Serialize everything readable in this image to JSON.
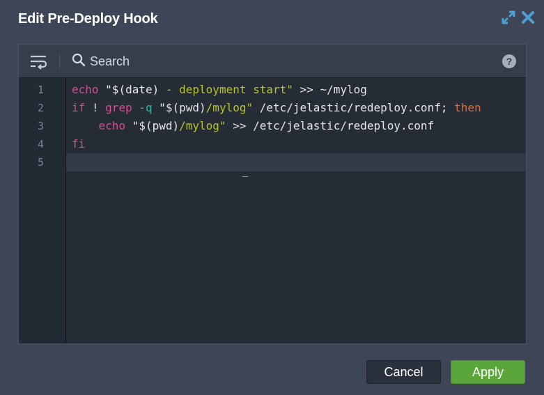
{
  "dialog": {
    "title": "Edit Pre-Deploy Hook"
  },
  "toolbar": {
    "wrap_icon": "word-wrap-icon",
    "search_label": "Search",
    "help_label": "?"
  },
  "editor": {
    "line_numbers": [
      "1",
      "2",
      "3",
      "4",
      "5"
    ],
    "lines": [
      {
        "tokens": [
          {
            "t": "echo",
            "c": "kw"
          },
          {
            "t": " ",
            "c": "plain"
          },
          {
            "t": "\"$(date) ",
            "c": "str-base"
          },
          {
            "t": "- deployment start\"",
            "c": "str"
          },
          {
            "t": " >> ~/mylog",
            "c": "plain"
          }
        ]
      },
      {
        "tokens": [
          {
            "t": "if",
            "c": "kw"
          },
          {
            "t": " ! ",
            "c": "plain"
          },
          {
            "t": "grep",
            "c": "kw"
          },
          {
            "t": " ",
            "c": "plain"
          },
          {
            "t": "-q",
            "c": "flag"
          },
          {
            "t": " \"$(pwd)",
            "c": "plain"
          },
          {
            "t": "/mylog\"",
            "c": "str"
          },
          {
            "t": " /etc/jelastic/redeploy.conf; ",
            "c": "plain"
          },
          {
            "t": "then",
            "c": "kw2"
          }
        ]
      },
      {
        "tokens": [
          {
            "t": "    ",
            "c": "plain"
          },
          {
            "t": "echo",
            "c": "kw"
          },
          {
            "t": " \"$(pwd)",
            "c": "plain"
          },
          {
            "t": "/mylog\"",
            "c": "str"
          },
          {
            "t": " >> /etc/jelastic/redeploy.conf",
            "c": "plain"
          }
        ]
      },
      {
        "tokens": [
          {
            "t": "fi",
            "c": "kw"
          }
        ]
      },
      {
        "tokens": []
      }
    ]
  },
  "buttons": {
    "cancel": "Cancel",
    "apply": "Apply"
  },
  "colors": {
    "keyword": "#d24c8c",
    "keyword_then": "#e06c3c",
    "string": "#b5c422",
    "flag": "#2fb5a6",
    "apply_button": "#5aa63b"
  }
}
